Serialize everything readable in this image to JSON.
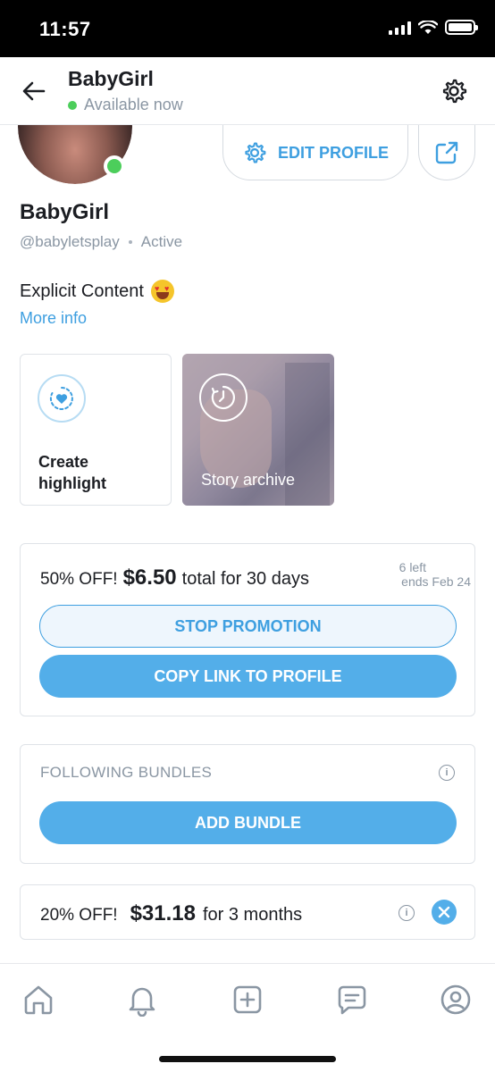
{
  "status_bar": {
    "time": "11:57"
  },
  "header": {
    "name": "BabyGirl",
    "status": "Available now"
  },
  "profile": {
    "edit_profile_label": "EDIT PROFILE",
    "name": "BabyGirl",
    "handle": "@babyletsplay",
    "activity": "Active",
    "bio": "Explicit Content",
    "more_info": "More info"
  },
  "highlights": {
    "create_label": "Create highlight",
    "archive_label": "Story archive"
  },
  "promotion": {
    "discount": "50% OFF!",
    "price": "$6.50",
    "description": "total for 30 days",
    "left": "6 left",
    "ends": "ends Feb 24",
    "stop_label": "STOP PROMOTION",
    "copy_label": "COPY LINK TO PROFILE"
  },
  "bundles": {
    "title": "FOLLOWING BUNDLES",
    "add_label": "ADD BUNDLE"
  },
  "bundle_offer": {
    "discount": "20% OFF!",
    "price": "$31.18",
    "description": "for 3 months"
  },
  "colors": {
    "accent": "#3e9fe0",
    "button_fill": "#53aee9",
    "online": "#4cce5b",
    "muted_text": "#8a96a3"
  },
  "nav": {
    "items": [
      "home-icon",
      "bell-icon",
      "plus-square-icon",
      "message-icon",
      "profile-icon"
    ]
  }
}
